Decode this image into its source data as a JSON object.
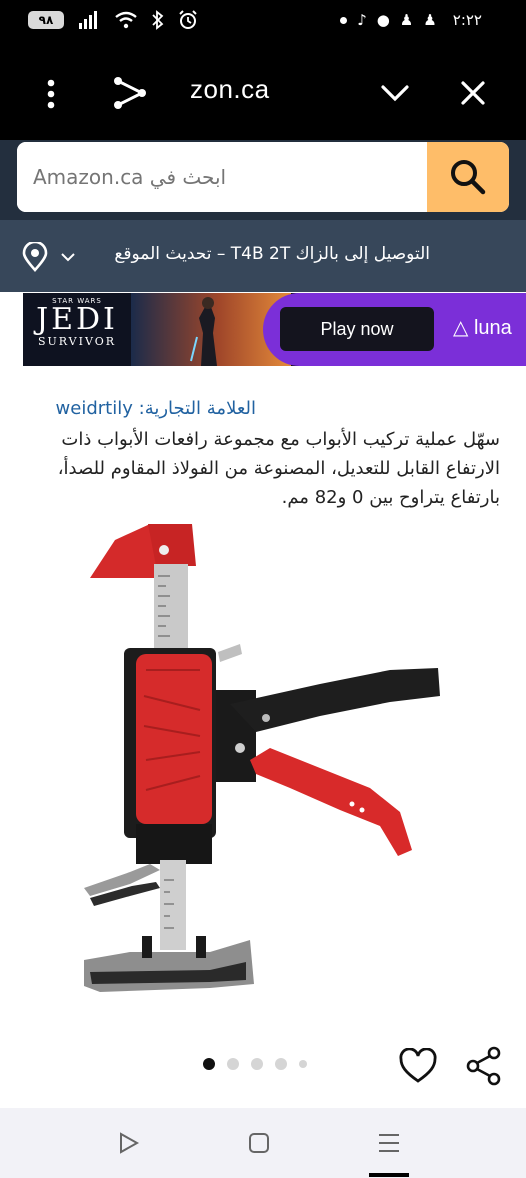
{
  "status_bar": {
    "battery": "٩٨",
    "time": "٢:٢٢"
  },
  "browser": {
    "url": "zon.ca"
  },
  "search": {
    "placeholder": "ابحث في Amazon.ca"
  },
  "delivery": {
    "text": "التوصيل إلى بالزاك T4B 2T – تحديث الموقع"
  },
  "ad": {
    "brand_top": "STAR WARS",
    "title": "JEDI",
    "subtitle": "SURVIVOR",
    "cta": "Play now",
    "provider": "luna"
  },
  "product": {
    "brand_label": "العلامة التجارية:",
    "brand_name": "weidrtily",
    "description": "سهّل عملية تركيب الأبواب مع مجموعة رافعات الأبواب ذات الارتفاع القابل للتعديل، المصنوعة من الفولاذ المقاوم للصدأ، بارتفاع يتراوح بين 0 و82 مم."
  },
  "carousel": {
    "count": 5,
    "active": 0
  }
}
